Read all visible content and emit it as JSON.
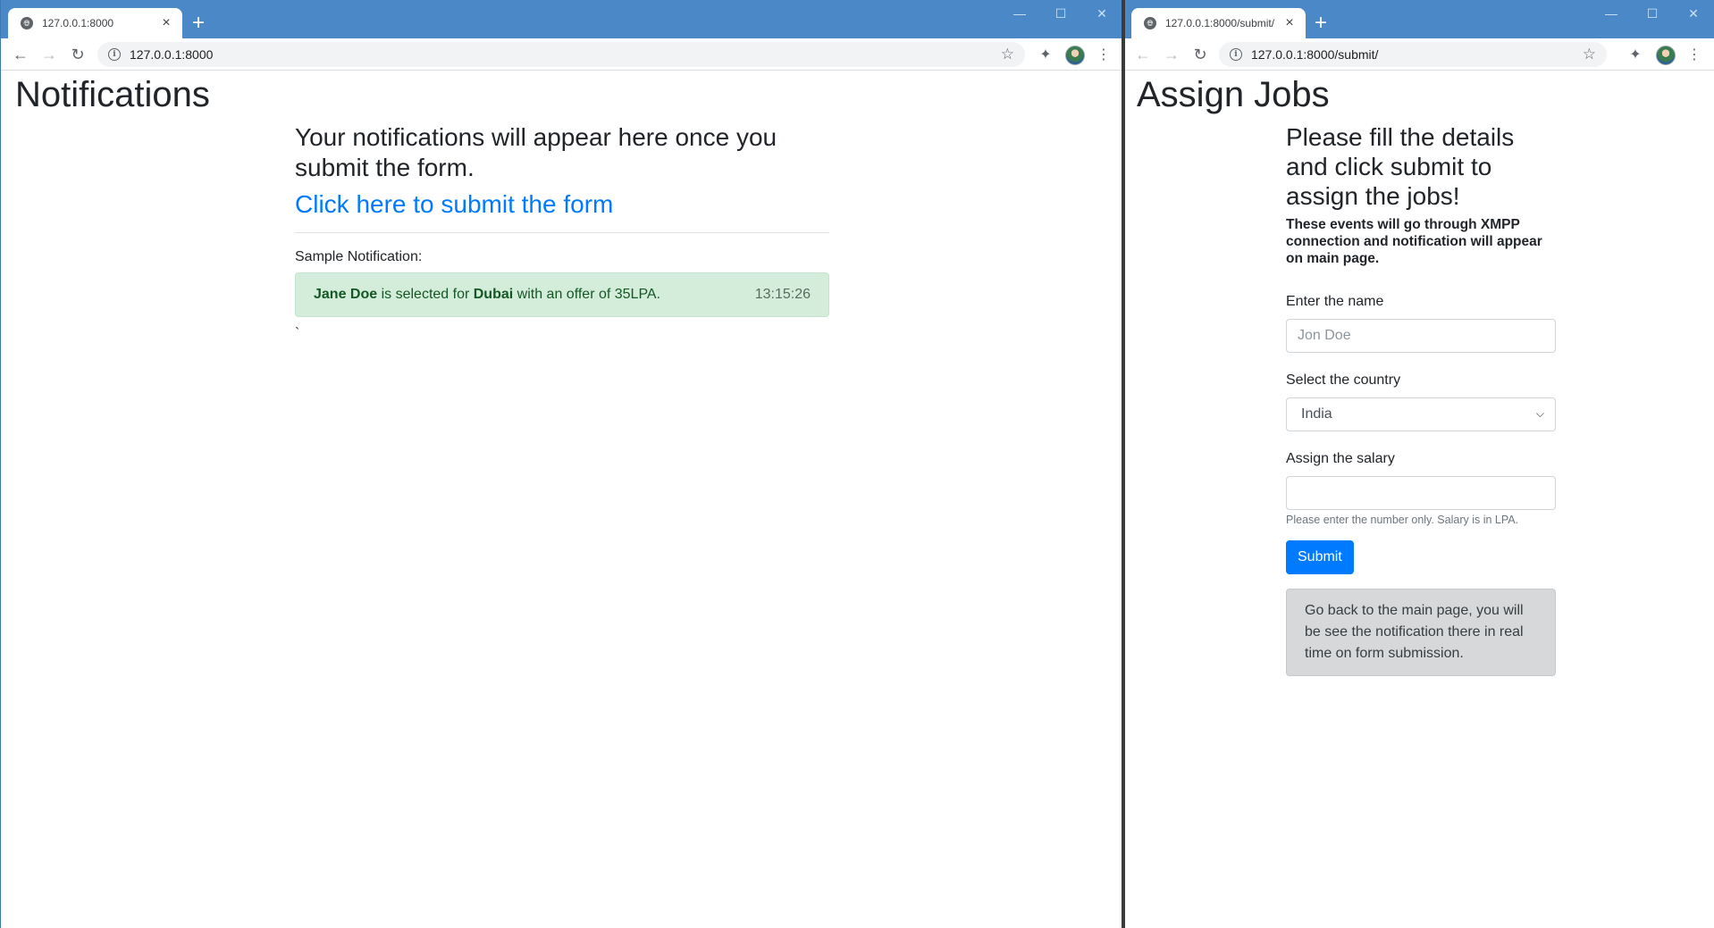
{
  "left_window": {
    "tab": {
      "title": "127.0.0.1:8000"
    },
    "url": "127.0.0.1:8000",
    "page": {
      "title": "Notifications",
      "lead": "Your notifications will appear here once you submit the form.",
      "form_link": "Click here to submit the form",
      "sample_label": "Sample Notification:",
      "notification": {
        "name": "Jane Doe",
        "text_1": " is selected for ",
        "place": "Dubai",
        "text_2": " with an offer of 35LPA.",
        "time": "13:15:26"
      },
      "trailing": "`"
    }
  },
  "right_window": {
    "tab": {
      "title": "127.0.0.1:8000/submit/"
    },
    "url": "127.0.0.1:8000/submit/",
    "page": {
      "title": "Assign Jobs",
      "heading": "Please fill the details and click submit to assign the jobs!",
      "subheading": "These events will go through XMPP connection and notification will appear on main page.",
      "name_label": "Enter the name",
      "name_placeholder": "Jon Doe",
      "country_label": "Select the country",
      "country_selected": "India",
      "salary_label": "Assign the salary",
      "salary_value": "",
      "salary_help": "Please enter the number only. Salary is in LPA.",
      "submit_label": "Submit",
      "info_text": "Go back to the main page, you will be see the notification there in real time on form submission."
    }
  },
  "icons": {
    "favicon": "globe-icon",
    "close": "close-icon",
    "new_tab": "plus-icon",
    "back": "arrow-left-icon",
    "forward": "arrow-right-icon",
    "reload": "reload-icon",
    "info": "info-icon",
    "bookmark": "star-icon",
    "extensions": "puzzle-icon",
    "menu": "kebab-menu-icon",
    "select_arrow": "chevron-down-icon"
  },
  "colors": {
    "titlebar": "#4a88c7",
    "link": "#007bff",
    "alert_success_bg": "#d4edda",
    "primary_button": "#007bff",
    "info_box_bg": "#d6d8d9"
  }
}
